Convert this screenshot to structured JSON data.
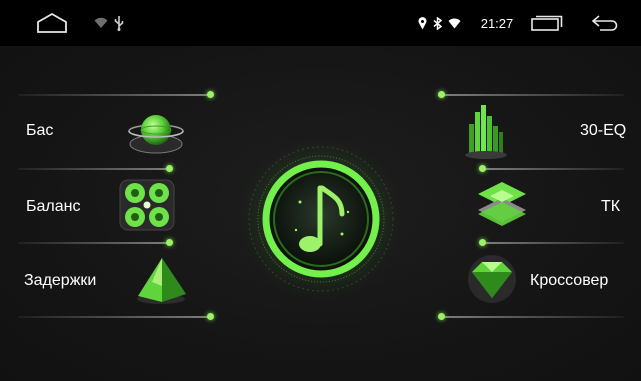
{
  "status_bar": {
    "time": "21:27",
    "icons": [
      "home-icon",
      "wifi-icon",
      "usb-icon",
      "location-icon",
      "bluetooth-icon",
      "signal-icon",
      "recent-apps-icon",
      "back-icon"
    ]
  },
  "menu": {
    "left": [
      {
        "label": "Бас",
        "icon": "sphere-icon"
      },
      {
        "label": "Баланс",
        "icon": "balance-speakers-icon"
      },
      {
        "label": "Задержки",
        "icon": "pyramid-icon"
      }
    ],
    "right": [
      {
        "label": "30-EQ",
        "icon": "equalizer-bars-icon"
      },
      {
        "label": "ТК",
        "icon": "layers-icon"
      },
      {
        "label": "Кроссовер",
        "icon": "diamond-icon"
      }
    ]
  },
  "center": {
    "icon": "music-note-icon"
  },
  "colors": {
    "accent": "#6de84a",
    "background": "#121212",
    "statusbar": "#000000"
  }
}
